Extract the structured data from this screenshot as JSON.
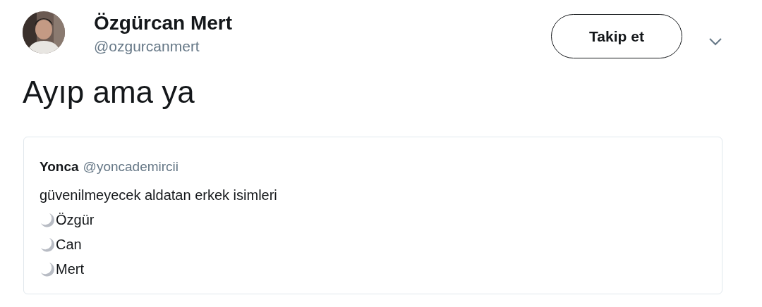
{
  "author": {
    "name": "Özgürcan Mert",
    "handle": "@ozgurcanmert"
  },
  "follow_button": {
    "label": "Takip et"
  },
  "tweet_text": "Ayıp ama ya",
  "quoted_tweet": {
    "name": "Yonca",
    "handle": "@yoncademircii",
    "lines": [
      {
        "kind": "plain",
        "text": "güvenilmeyecek aldatan erkek isimleri"
      },
      {
        "kind": "moon",
        "text": "Özgür"
      },
      {
        "kind": "moon",
        "text": "Can"
      },
      {
        "kind": "moon",
        "text": "Mert"
      }
    ]
  }
}
